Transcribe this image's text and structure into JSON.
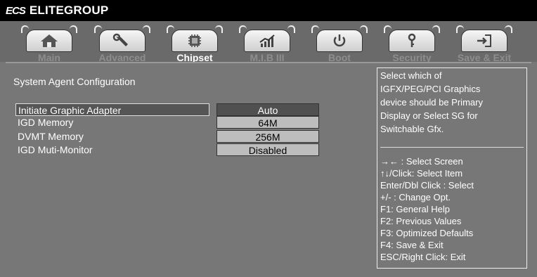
{
  "brand": {
    "mark": "ECS",
    "name": "ELITEGROUP"
  },
  "tabs": [
    {
      "label": "Main",
      "icon": "home-icon"
    },
    {
      "label": "Advanced",
      "icon": "wrench-icon"
    },
    {
      "label": "Chipset",
      "icon": "chip-icon",
      "active": true
    },
    {
      "label": "M.I.B III",
      "icon": "chart-icon"
    },
    {
      "label": "Boot",
      "icon": "power-icon"
    },
    {
      "label": "Security",
      "icon": "key-icon"
    },
    {
      "label": "Save & Exit",
      "icon": "exit-icon"
    }
  ],
  "section_title": "System Agent Configuration",
  "settings": [
    {
      "label": "Initiate Graphic Adapter",
      "value": "Auto",
      "selected": true
    },
    {
      "label": "IGD Memory",
      "value": "64M"
    },
    {
      "label": "DVMT Memory",
      "value": "256M"
    },
    {
      "label": "IGD Muti-Monitor",
      "value": "Disabled"
    }
  ],
  "help": {
    "description": [
      "Select which of",
      "IGFX/PEG/PCI Graphics",
      "device should be Primary",
      "Display or Select SG for",
      "Switchable Gfx."
    ],
    "keys": [
      "→←  : Select Screen",
      "↑↓/Click: Select Item",
      "Enter/Dbl Click : Select",
      "+/- : Change Opt.",
      "F1: General Help",
      "F2: Previous Values",
      "F3: Optimized Defaults",
      "F4: Save & Exit",
      "ESC/Right Click: Exit"
    ]
  }
}
